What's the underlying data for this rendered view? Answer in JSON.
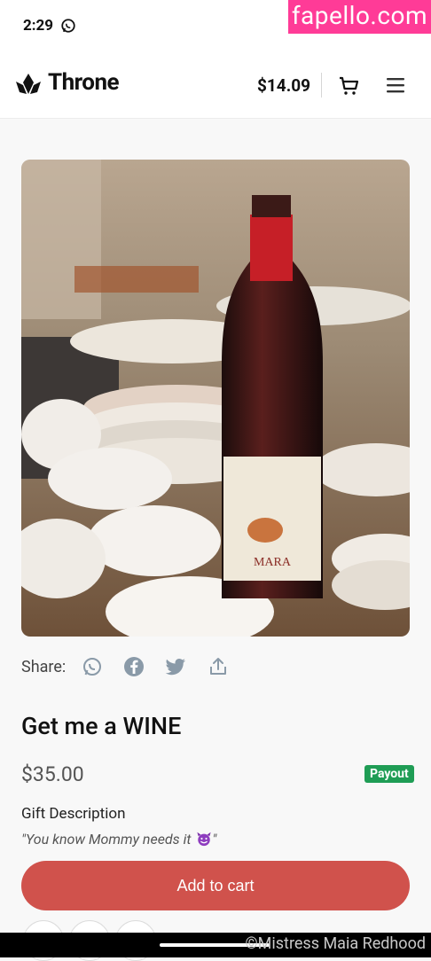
{
  "status_bar": {
    "time": "2:29"
  },
  "watermark_top": "fapello.com",
  "header": {
    "brand": "Throne",
    "balance": "$14.09"
  },
  "share": {
    "label": "Share:"
  },
  "product": {
    "title": "Get me a WINE",
    "price": "$35.00",
    "badge": "Payout",
    "gift_label": "Gift Description",
    "gift_description": "\"You know Mommy needs it ",
    "gift_description_end": "\""
  },
  "actions": {
    "add_to_cart": "Add to cart"
  },
  "watermark_bottom": "©Mistress Maia Redhood",
  "colors": {
    "accent": "#d0524c",
    "payout": "#1f9d55",
    "watermark": "#ff3b97"
  }
}
